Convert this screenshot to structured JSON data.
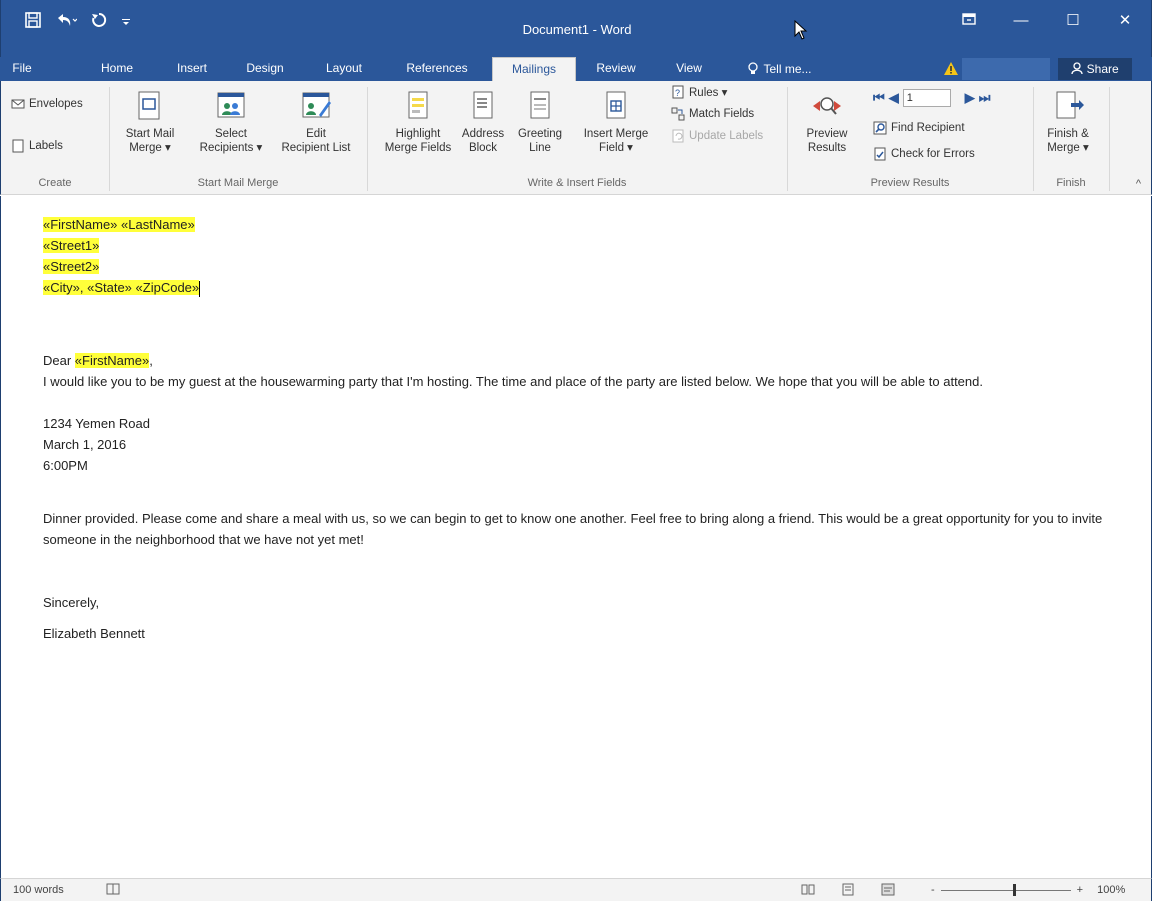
{
  "window": {
    "title": "Document1 - Word",
    "qat": {
      "save_icon": "save-icon",
      "undo_icon": "undo-icon",
      "redo_icon": "redo-icon",
      "customize_icon": "customize-qat-icon"
    },
    "controls": {
      "ribbon_display": "ribbon-display-icon",
      "minimize": "—",
      "maximize": "☐",
      "close": "✕"
    }
  },
  "tabs": [
    {
      "label": "File"
    },
    {
      "label": "Home"
    },
    {
      "label": "Insert"
    },
    {
      "label": "Design"
    },
    {
      "label": "Layout"
    },
    {
      "label": "References"
    },
    {
      "label": "Mailings",
      "active": true
    },
    {
      "label": "Review"
    },
    {
      "label": "View"
    },
    {
      "label": "Tell me..."
    }
  ],
  "share_label": "Share",
  "ribbon": {
    "create": {
      "label": "Create",
      "envelopes": "Envelopes",
      "labels": "Labels"
    },
    "start_mail_merge": {
      "label": "Start Mail Merge",
      "start_line1": "Start Mail",
      "start_line2": "Merge ▾",
      "select_line1": "Select",
      "select_line2": "Recipients ▾",
      "edit_line1": "Edit",
      "edit_line2": "Recipient List"
    },
    "write_insert": {
      "label": "Write & Insert Fields",
      "highlight_line1": "Highlight",
      "highlight_line2": "Merge Fields",
      "address_line1": "Address",
      "address_line2": "Block",
      "greeting_line1": "Greeting",
      "greeting_line2": "Line",
      "insert_line1": "Insert Merge",
      "insert_line2": "Field ▾",
      "rules": "Rules ▾",
      "match_fields": "Match Fields",
      "update_labels": "Update Labels"
    },
    "preview": {
      "label": "Preview Results",
      "preview_line1": "Preview",
      "preview_line2": "Results",
      "record": "1",
      "find_recipient": "Find Recipient",
      "check_errors": "Check for Errors"
    },
    "finish": {
      "label": "Finish",
      "finish_line1": "Finish &",
      "finish_line2": "Merge ▾"
    }
  },
  "document": {
    "address": {
      "first": "«FirstName»",
      "last": "«LastName»",
      "street1": "«Street1»",
      "street2": "«Street2»",
      "city": "«City»",
      "comma": ", ",
      "state": "«State»",
      "zip": "«ZipCode»"
    },
    "greeting_prefix": "Dear ",
    "greeting_field": "«FirstName»",
    "greeting_suffix": ",",
    "para1": "I would like you to be my guest at the housewarming party that I'm hosting. The time and place of the party are listed below. We hope that you will be able to attend.",
    "details": [
      "1234 Yemen Road",
      "March 1, 2016",
      "6:00PM"
    ],
    "para2": "Dinner provided. Please come and share a meal with us, so we can begin to get to know one another. Feel free to bring along a friend.  This would be a great opportunity for you to invite someone in the neighborhood that we have not yet met!",
    "closing": "Sincerely,",
    "signature": "Elizabeth Bennett"
  },
  "status": {
    "word_count": "100 words",
    "zoom_minus": "-",
    "zoom_plus": "+",
    "zoom": "100%"
  },
  "colors": {
    "brand": "#2b579a",
    "highlight": "#ffff3a"
  }
}
